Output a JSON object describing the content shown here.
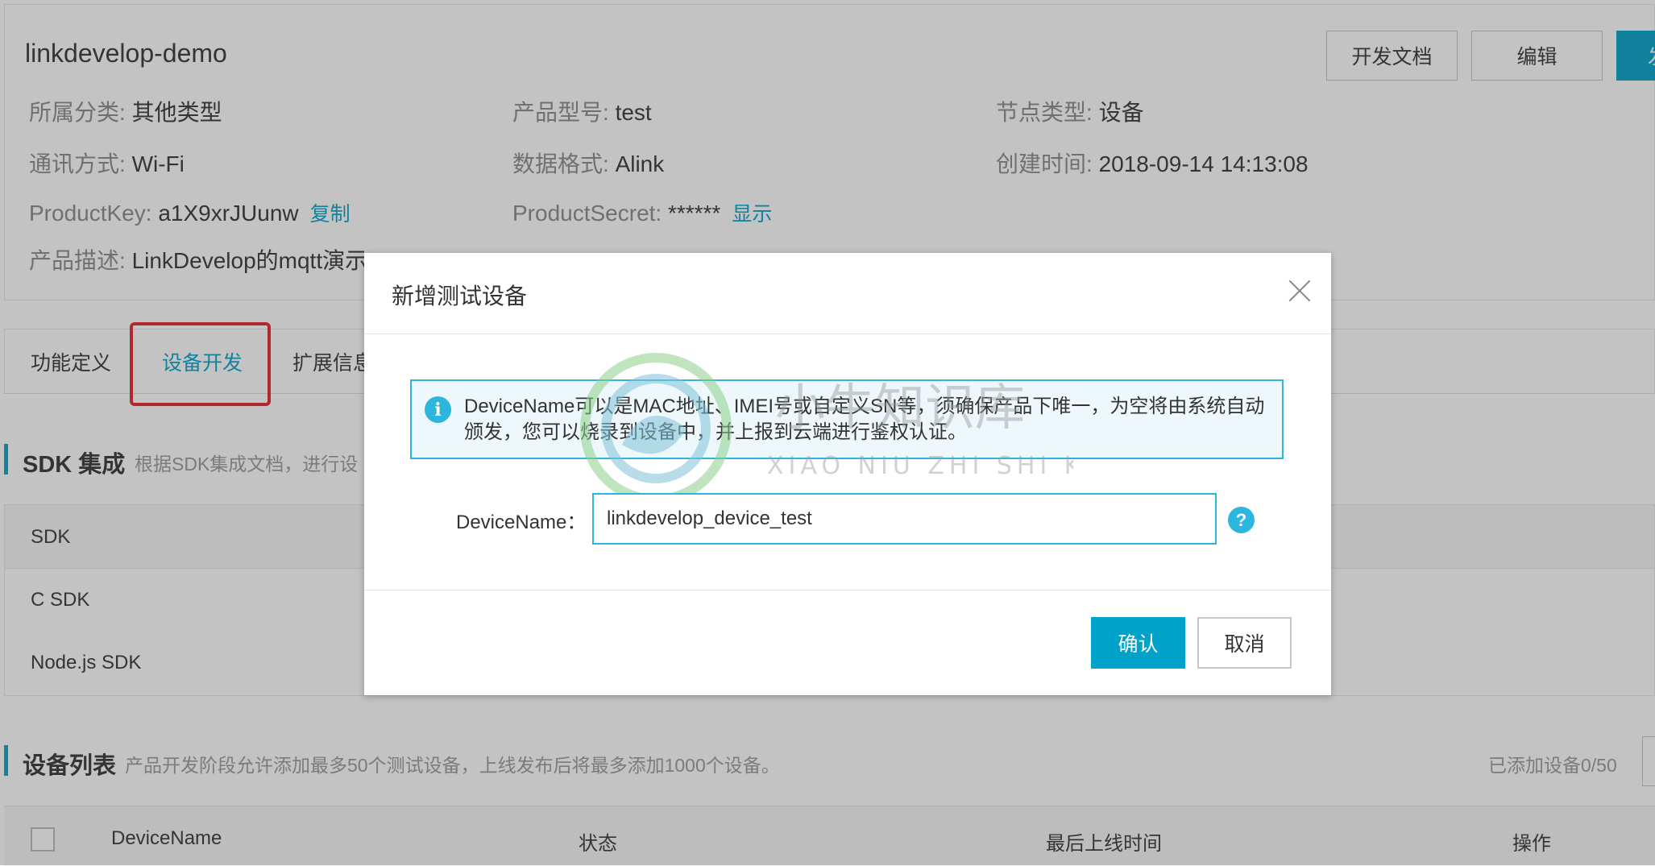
{
  "product": {
    "name": "linkdevelop-demo",
    "buttons": {
      "dev_docs": "开发文档",
      "edit": "编辑",
      "publish": "发"
    },
    "info": {
      "category_label": "所属分类:",
      "category_value": "其他类型",
      "model_label": "产品型号:",
      "model_value": "test",
      "node_label": "节点类型:",
      "node_value": "设备",
      "comm_label": "通讯方式:",
      "comm_value": "Wi-Fi",
      "format_label": "数据格式:",
      "format_value": "Alink",
      "created_label": "创建时间:",
      "created_value": "2018-09-14 14:13:08",
      "key_label": "ProductKey:",
      "key_value": "a1X9xrJUunw",
      "key_copy": "复制",
      "secret_label": "ProductSecret:",
      "secret_value": "******",
      "secret_show": "显示",
      "desc_label": "产品描述:",
      "desc_value": "LinkDevelop的mqtt演示"
    }
  },
  "tabs": [
    "功能定义",
    "设备开发",
    "扩展信息"
  ],
  "sdk_section": {
    "title": "SDK 集成",
    "desc": "根据SDK集成文档，进行设",
    "header": "SDK",
    "rows": [
      "C SDK",
      "Node.js SDK"
    ]
  },
  "device_section": {
    "title": "设备列表",
    "desc": "产品开发阶段允许添加最多50个测试设备，上线发布后将最多添加1000个设备。",
    "count": "已添加设备0/50",
    "columns": [
      "DeviceName",
      "状态",
      "最后上线时间",
      "操作"
    ]
  },
  "modal": {
    "title": "新增测试设备",
    "notice": "DeviceName可以是MAC地址、IMEI号或自定义SN等，须确保产品下唯一，为空将由系统自动颁发，您可以烧录到设备中，并上报到云端进行鉴权认证。",
    "field_label": "DeviceName：",
    "field_value": "linkdevelop_device_test",
    "confirm": "确认",
    "cancel": "取消"
  },
  "watermark": {
    "cn": "小牛知识库",
    "en": "XIAO NIU ZHI SHI KU"
  },
  "colors": {
    "accent": "#00a2ca",
    "highlight": "#e3222a"
  }
}
